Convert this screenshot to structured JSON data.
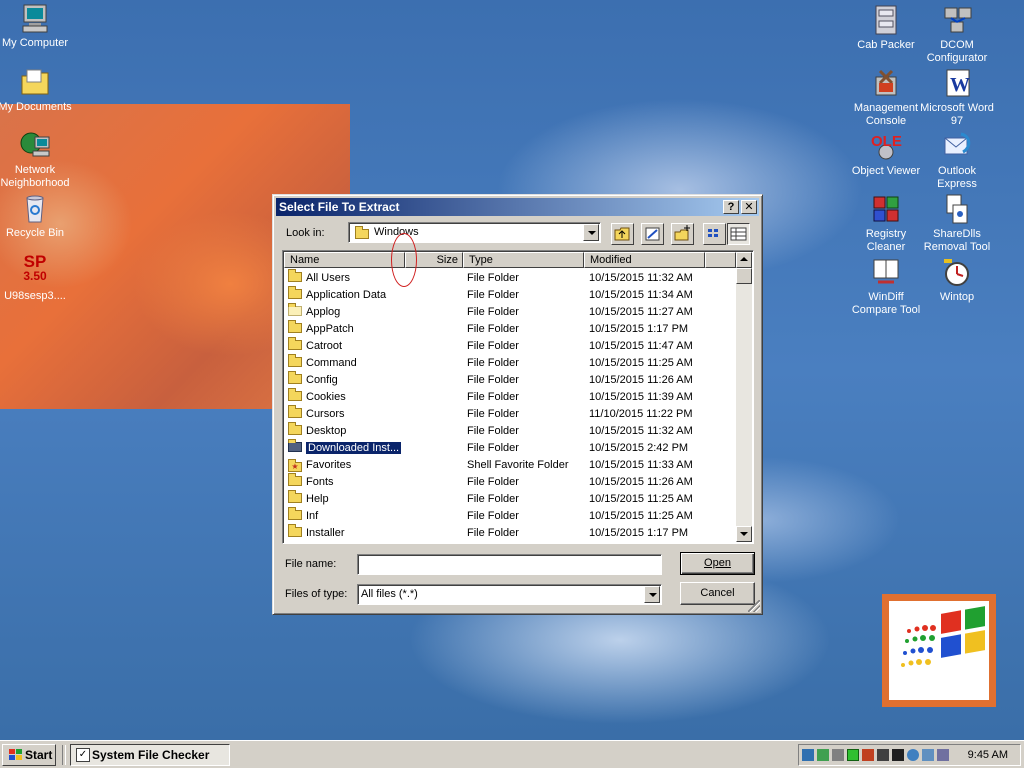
{
  "desktop": {
    "icons_left": [
      {
        "label": "My Computer",
        "icon": "computer-icon"
      },
      {
        "label": "My Documents",
        "icon": "documents-folder-icon"
      },
      {
        "label": "Network Neighborhood",
        "icon": "network-icon"
      },
      {
        "label": "Recycle Bin",
        "icon": "recycle-bin-icon"
      },
      {
        "label": "U98sesp3....",
        "icon": "sp-package-icon",
        "badge_line1": "SP",
        "badge_line2": "3.50"
      }
    ],
    "icons_right": [
      {
        "label": "Cab Packer",
        "icon": "cab-packer-icon"
      },
      {
        "label": "DCOM Configurator",
        "icon": "dcom-icon"
      },
      {
        "label": "Management Console",
        "icon": "management-console-icon"
      },
      {
        "label": "Microsoft Word 97",
        "icon": "word-icon",
        "glyph": "W"
      },
      {
        "label": "Object Viewer",
        "icon": "ole-viewer-icon",
        "glyph": "OLE"
      },
      {
        "label": "Outlook Express",
        "icon": "outlook-express-icon"
      },
      {
        "label": "Registry Cleaner",
        "icon": "registry-cleaner-icon"
      },
      {
        "label": "ShareDlls Removal Tool",
        "icon": "sharedlls-icon"
      },
      {
        "label": "WinDiff Compare Tool",
        "icon": "windiff-icon"
      },
      {
        "label": "Wintop",
        "icon": "wintop-icon"
      }
    ]
  },
  "dialog": {
    "title": "Select File To Extract",
    "help_button": "?",
    "close_button": "✕",
    "look_in_label": "Look in:",
    "look_in_value": "Windows",
    "columns": [
      "Name",
      "Size",
      "Type",
      "Modified"
    ],
    "rows": [
      {
        "name": "All Users",
        "size": "",
        "type": "File Folder",
        "modified": "10/15/2015 11:32 AM"
      },
      {
        "name": "Application Data",
        "size": "",
        "type": "File Folder",
        "modified": "10/15/2015 11:34 AM"
      },
      {
        "name": "Applog",
        "size": "",
        "type": "File Folder",
        "modified": "10/15/2015 11:27 AM"
      },
      {
        "name": "AppPatch",
        "size": "",
        "type": "File Folder",
        "modified": "10/15/2015 1:17 PM"
      },
      {
        "name": "Catroot",
        "size": "",
        "type": "File Folder",
        "modified": "10/15/2015 11:47 AM"
      },
      {
        "name": "Command",
        "size": "",
        "type": "File Folder",
        "modified": "10/15/2015 11:25 AM"
      },
      {
        "name": "Config",
        "size": "",
        "type": "File Folder",
        "modified": "10/15/2015 11:26 AM"
      },
      {
        "name": "Cookies",
        "size": "",
        "type": "File Folder",
        "modified": "10/15/2015 11:39 AM"
      },
      {
        "name": "Cursors",
        "size": "",
        "type": "File Folder",
        "modified": "11/10/2015 11:22 PM"
      },
      {
        "name": "Desktop",
        "size": "",
        "type": "File Folder",
        "modified": "10/15/2015 11:32 AM"
      },
      {
        "name": "Downloaded Inst...",
        "size": "",
        "type": "File Folder",
        "modified": "10/15/2015 2:42 PM",
        "selected": true
      },
      {
        "name": "Favorites",
        "size": "",
        "type": "Shell Favorite Folder",
        "modified": "10/15/2015 11:33 AM"
      },
      {
        "name": "Fonts",
        "size": "",
        "type": "File Folder",
        "modified": "10/15/2015 11:26 AM"
      },
      {
        "name": "Help",
        "size": "",
        "type": "File Folder",
        "modified": "10/15/2015 11:25 AM"
      },
      {
        "name": "Inf",
        "size": "",
        "type": "File Folder",
        "modified": "10/15/2015 11:25 AM"
      },
      {
        "name": "Installer",
        "size": "",
        "type": "File Folder",
        "modified": "10/15/2015 1:17 PM"
      }
    ],
    "file_name_label": "File name:",
    "file_name_value": "",
    "files_of_type_label": "Files of type:",
    "files_of_type_value": "All files (*.*)",
    "open_button": "Open",
    "cancel_button": "Cancel"
  },
  "taskbar": {
    "start_label": "Start",
    "tasks": [
      {
        "label": "System File Checker"
      }
    ],
    "clock": "9:45 AM"
  },
  "colors": {
    "desktop": "#3a6ea5",
    "titlebar_start": "#0a246a",
    "titlebar_end": "#a6caf0",
    "selection": "#0a246a",
    "face": "#d4d0c8"
  }
}
